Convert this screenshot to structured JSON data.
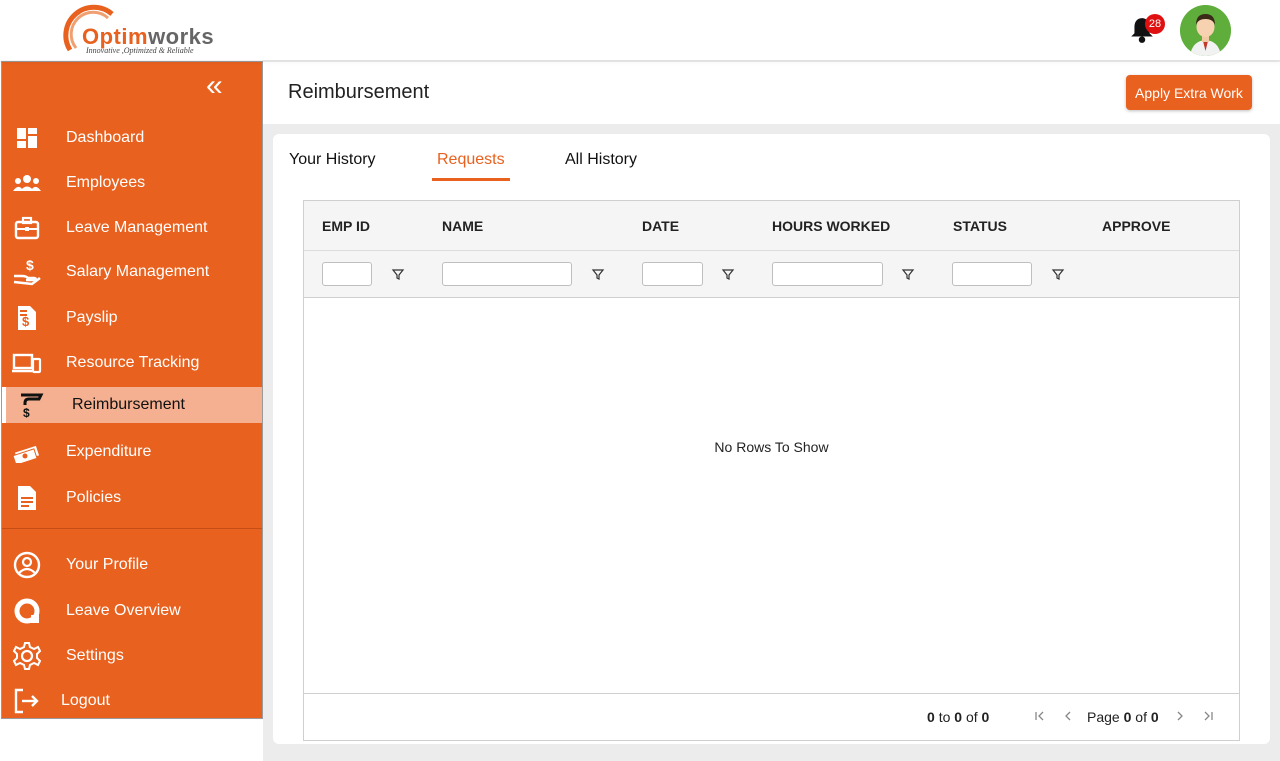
{
  "header": {
    "logo_brand_part1": "Optim",
    "logo_brand_part2": "works",
    "logo_tagline": "Innovative ,Optimized & Reliable",
    "notification_count": "28"
  },
  "sidebar": {
    "collapse_glyph": "«",
    "items": [
      {
        "label": "Dashboard",
        "icon": "dashboard-icon"
      },
      {
        "label": "Employees",
        "icon": "employees-icon"
      },
      {
        "label": "Leave Management",
        "icon": "briefcase-icon"
      },
      {
        "label": "Salary Management",
        "icon": "salary-hand-icon"
      },
      {
        "label": "Payslip",
        "icon": "payslip-icon"
      },
      {
        "label": "Resource Tracking",
        "icon": "devices-icon"
      },
      {
        "label": "Reimbursement",
        "icon": "reimbursement-icon",
        "active": true
      },
      {
        "label": "Expenditure",
        "icon": "money-icon"
      },
      {
        "label": "Policies",
        "icon": "document-icon"
      },
      {
        "label": "Your Profile",
        "icon": "profile-icon"
      },
      {
        "label": "Leave Overview",
        "icon": "leave-overview-icon"
      },
      {
        "label": "Settings",
        "icon": "gear-icon"
      },
      {
        "label": "Logout",
        "icon": "logout-icon"
      }
    ]
  },
  "main": {
    "title": "Reimbursement",
    "apply_button": "Apply Extra Work",
    "tabs": [
      {
        "label": "Your History"
      },
      {
        "label": "Requests",
        "active": true
      },
      {
        "label": "All History"
      }
    ],
    "grid": {
      "columns": [
        "EMP ID",
        "NAME",
        "DATE",
        "HOURS WORKED",
        "STATUS",
        "APPROVE"
      ],
      "empty_message": "No Rows To Show",
      "footer": {
        "range_from": "0",
        "range_to_word": "to",
        "range_to": "0",
        "range_of_word": "of",
        "range_total": "0",
        "page_word": "Page",
        "page_current": "0",
        "page_of_word": "of",
        "page_total": "0"
      }
    }
  },
  "colors": {
    "accent": "#e8611f",
    "active_item_bg": "#f4b090",
    "badge": "#e01010"
  }
}
